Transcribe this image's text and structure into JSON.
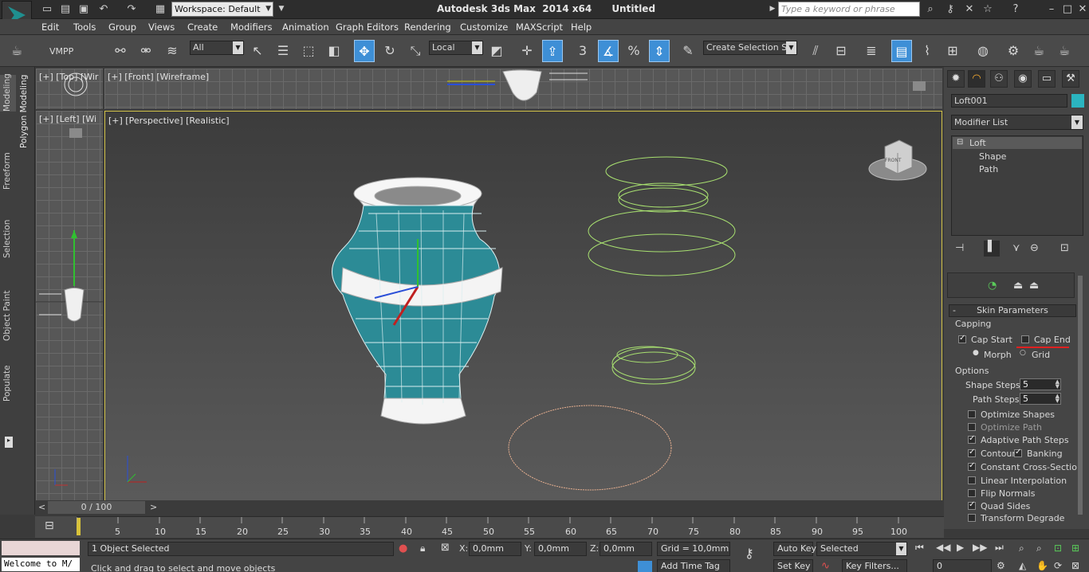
{
  "titlebar": {
    "workspace": "Workspace: Default",
    "title": "Autodesk 3ds Max  2014 x64      Untitled",
    "search_placeholder": "Type a keyword or phrase"
  },
  "menu": [
    "Edit",
    "Tools",
    "Group",
    "Views",
    "Create",
    "Modifiers",
    "Animation",
    "Graph Editors",
    "Rendering",
    "Customize",
    "MAXScript",
    "Help"
  ],
  "toolbar": {
    "vmpp": "VMPP",
    "selection_filter": "All",
    "coord_system": "Local",
    "create_selection_set": "Create Selection Se"
  },
  "left_tabs": [
    "Modeling",
    "Freeform",
    "Selection",
    "Object Paint",
    "Populate"
  ],
  "polygon_modeling_label": "Polygon Modeling",
  "viewports": {
    "top": "[+] [Top] [Wir",
    "front": "[+] [Front] [Wireframe]",
    "left": "[+] [Left] [Wi",
    "perspective": "[+] [Perspective] [Realistic]"
  },
  "viewcube_label": "FRONT",
  "command_panel": {
    "object_name": "Loft001",
    "object_color": "#2bb5c0",
    "modifier_list": "Modifier List",
    "stack": [
      "Loft",
      "Shape",
      "Path"
    ],
    "rollout_title": "Skin Parameters",
    "capping_group": "Capping",
    "cap_start": {
      "label": "Cap Start",
      "checked": true
    },
    "cap_end": {
      "label": "Cap End",
      "checked": false
    },
    "morph": {
      "label": "Morph",
      "selected": true
    },
    "grid": {
      "label": "Grid",
      "selected": false
    },
    "options_group": "Options",
    "shape_steps": {
      "label": "Shape Steps:",
      "value": "5"
    },
    "path_steps": {
      "label": "Path Steps:",
      "value": "5"
    },
    "options": [
      {
        "label": "Optimize Shapes",
        "checked": false
      },
      {
        "label": "Optimize Path",
        "checked": false
      },
      {
        "label": "Adaptive Path Steps",
        "checked": true
      },
      {
        "label": "Contour",
        "checked": true
      },
      {
        "label": "Constant Cross-Section",
        "checked": true
      },
      {
        "label": "Linear Interpolation",
        "checked": false
      },
      {
        "label": "Flip Normals",
        "checked": false
      },
      {
        "label": "Quad Sides",
        "checked": true
      },
      {
        "label": "Transform Degrade",
        "checked": false
      }
    ],
    "banking": {
      "label": "Banking",
      "checked": true
    }
  },
  "timeline": {
    "frame": "0 / 100",
    "ticks": [
      "5",
      "10",
      "15",
      "20",
      "25",
      "30",
      "35",
      "40",
      "45",
      "50",
      "55",
      "60",
      "65",
      "70",
      "75",
      "80",
      "85",
      "90",
      "95",
      "100"
    ]
  },
  "status": {
    "listener": "Welcome to M/",
    "selected": "1 Object Selected",
    "prompt": "Click and drag to select and move objects",
    "x_label": "X:",
    "x": "0,0mm",
    "y_label": "Y:",
    "y": "0,0mm",
    "z_label": "Z:",
    "z": "0,0mm",
    "grid": "Grid = 10,0mm",
    "auto_key": "Auto Key",
    "set_key": "Set Key",
    "key_mode": "Selected",
    "key_filters": "Key Filters...",
    "add_time_tag": "Add Time Tag",
    "current_frame": "0"
  }
}
